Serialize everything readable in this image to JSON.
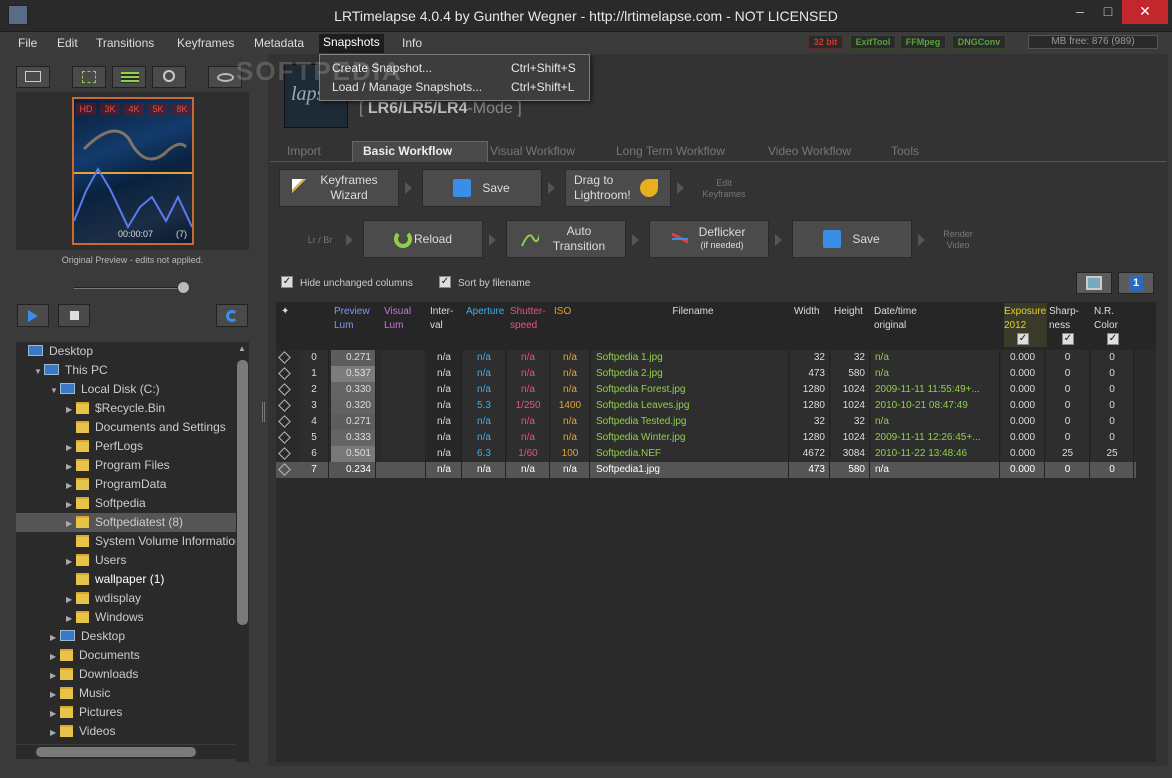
{
  "window": {
    "title": "LRTimelapse 4.0.4 by Gunther Wegner - http://lrtimelapse.com - NOT LICENSED"
  },
  "menu": [
    "File",
    "Edit",
    "Transitions",
    "Keyframes",
    "Metadata",
    "Snapshots",
    "Info"
  ],
  "badges": [
    {
      "label": "32 bit",
      "color": "#e03030"
    },
    {
      "label": "ExifTool",
      "color": "#5aa040"
    },
    {
      "label": "FFMpeg",
      "color": "#5aa040"
    },
    {
      "label": "DNGConv",
      "color": "#5aa040"
    }
  ],
  "mb_free": "MB free: 876  (989)",
  "snapshot_menu": [
    {
      "label": "Create Snapshot...",
      "shortcut": "Ctrl+Shift+S"
    },
    {
      "label": "Load / Manage Snapshots...",
      "shortcut": "Ctrl+Shift+L"
    }
  ],
  "watermark": "SOFTPEDIA",
  "preview": {
    "resolutions": [
      "HD",
      "3K",
      "4K",
      "5K",
      "8K"
    ],
    "time": "00:00:07",
    "count": "(7)",
    "caption": "Original Preview - edits not applied.",
    "slider": 0.95
  },
  "tree": [
    {
      "label": "Desktop",
      "indent": 0,
      "arrow": "",
      "icon": "desktop"
    },
    {
      "label": "This PC",
      "indent": 1,
      "arrow": "▼",
      "icon": "pc"
    },
    {
      "label": "Local Disk (C:)",
      "indent": 2,
      "arrow": "▼",
      "icon": "disk"
    },
    {
      "label": "$Recycle.Bin",
      "indent": 3,
      "arrow": "▶",
      "icon": "folder"
    },
    {
      "label": "Documents and Settings",
      "indent": 3,
      "arrow": "",
      "icon": "folder-link"
    },
    {
      "label": "PerfLogs",
      "indent": 3,
      "arrow": "▶",
      "icon": "folder"
    },
    {
      "label": "Program Files",
      "indent": 3,
      "arrow": "▶",
      "icon": "folder"
    },
    {
      "label": "ProgramData",
      "indent": 3,
      "arrow": "▶",
      "icon": "folder"
    },
    {
      "label": "Softpedia",
      "indent": 3,
      "arrow": "▶",
      "icon": "folder"
    },
    {
      "label": "Softpediatest (8)",
      "indent": 3,
      "arrow": "▶",
      "icon": "folder",
      "selected": true
    },
    {
      "label": "System Volume Information",
      "indent": 3,
      "arrow": "",
      "icon": "folder"
    },
    {
      "label": "Users",
      "indent": 3,
      "arrow": "▶",
      "icon": "folder"
    },
    {
      "label": "wallpaper (1)",
      "indent": 3,
      "arrow": "",
      "icon": "folder",
      "bright": true
    },
    {
      "label": "wdisplay",
      "indent": 3,
      "arrow": "▶",
      "icon": "folder"
    },
    {
      "label": "Windows",
      "indent": 3,
      "arrow": "▶",
      "icon": "folder"
    },
    {
      "label": "Desktop",
      "indent": 2,
      "arrow": "▶",
      "icon": "desktop"
    },
    {
      "label": "Documents",
      "indent": 2,
      "arrow": "▶",
      "icon": "folder"
    },
    {
      "label": "Downloads",
      "indent": 2,
      "arrow": "▶",
      "icon": "folder"
    },
    {
      "label": "Music",
      "indent": 2,
      "arrow": "▶",
      "icon": "folder"
    },
    {
      "label": "Pictures",
      "indent": 2,
      "arrow": "▶",
      "icon": "folder"
    },
    {
      "label": "Videos",
      "indent": 2,
      "arrow": "▶",
      "icon": "folder"
    }
  ],
  "mode": {
    "prefix": "[ ",
    "bold": "LR6/LR5/LR4",
    "suffix": "-Mode ]"
  },
  "tabs": [
    "Import",
    "Basic Workflow",
    "Visual Workflow",
    "Long Term Workflow",
    "Video Workflow",
    "Tools"
  ],
  "workflow": {
    "row1": [
      {
        "label": "Keyframes\nWizard",
        "icon": "wand-icon"
      },
      {
        "label": "Save",
        "icon": "xmp-save-icon"
      },
      {
        "label": "Drag to\nLightroom!",
        "icon": "drag-arrow-icon"
      }
    ],
    "row1_hint": "Edit\nKeyframes",
    "row2_hint_left": "Lr / Br",
    "row2": [
      {
        "label": "Reload",
        "icon": "reload-icon"
      },
      {
        "label": "Auto\nTransition",
        "icon": "curve-icon"
      },
      {
        "label": "Deflicker",
        "sub": "(if needed)",
        "icon": "deflicker-icon"
      },
      {
        "label": "Save",
        "icon": "xmp-save-icon"
      }
    ],
    "row2_hint": "Render\nVideo"
  },
  "options": {
    "hide_unchanged": "Hide unchanged columns",
    "sort_by_filename": "Sort by filename"
  },
  "columns": [
    {
      "key": "sel",
      "label": "✦",
      "color": "#ddd"
    },
    {
      "key": "idx",
      "label": "",
      "color": "#ddd"
    },
    {
      "key": "prev",
      "label": "Preview\nLum",
      "color": "#7b9bf5"
    },
    {
      "key": "vis",
      "label": "Visual\nLum",
      "color": "#c774e0"
    },
    {
      "key": "int",
      "label": "Inter-\nval",
      "color": "#ddd"
    },
    {
      "key": "ap",
      "label": "Aperture",
      "color": "#3ab0e8"
    },
    {
      "key": "sh",
      "label": "Shutter-\nspeed",
      "color": "#e8508a"
    },
    {
      "key": "iso",
      "label": "ISO",
      "color": "#e8a030"
    },
    {
      "key": "fn",
      "label": "Filename",
      "color": "#ddd"
    },
    {
      "key": "w",
      "label": "Width",
      "color": "#ddd"
    },
    {
      "key": "h",
      "label": "Height",
      "color": "#ddd"
    },
    {
      "key": "dt",
      "label": "Date/time\noriginal",
      "color": "#ddd"
    },
    {
      "key": "exp",
      "label": "Exposure\n2012",
      "color": "#e8d020"
    },
    {
      "key": "sharp",
      "label": "Sharp-\nness",
      "color": "#ddd"
    },
    {
      "key": "nr",
      "label": "N.R.\nColor",
      "color": "#ddd"
    }
  ],
  "rows": [
    {
      "idx": "0",
      "prev": "0.271",
      "int": "n/a",
      "ap": "n/a",
      "sh": "n/a",
      "iso": "n/a",
      "fn": "Softpedia 1.jpg",
      "w": "32",
      "h": "32",
      "dt": "n/a",
      "exp": "0.000",
      "sharp": "0",
      "nr": "0"
    },
    {
      "idx": "1",
      "prev": "0.537",
      "int": "n/a",
      "ap": "n/a",
      "sh": "n/a",
      "iso": "n/a",
      "fn": "Softpedia 2.jpg",
      "w": "473",
      "h": "580",
      "dt": "n/a",
      "exp": "0.000",
      "sharp": "0",
      "nr": "0"
    },
    {
      "idx": "2",
      "prev": "0.330",
      "int": "n/a",
      "ap": "n/a",
      "sh": "n/a",
      "iso": "n/a",
      "fn": "Softpedia Forest.jpg",
      "w": "1280",
      "h": "1024",
      "dt": "2009-11-11 11:55:49+...",
      "exp": "0.000",
      "sharp": "0",
      "nr": "0"
    },
    {
      "idx": "3",
      "prev": "0.320",
      "int": "n/a",
      "ap": "5.3",
      "sh": "1/250",
      "iso": "1400",
      "fn": "Softpedia Leaves.jpg",
      "w": "1280",
      "h": "1024",
      "dt": "2010-10-21 08:47:49",
      "exp": "0.000",
      "sharp": "0",
      "nr": "0"
    },
    {
      "idx": "4",
      "prev": "0.271",
      "int": "n/a",
      "ap": "n/a",
      "sh": "n/a",
      "iso": "n/a",
      "fn": "Softpedia Tested.jpg",
      "w": "32",
      "h": "32",
      "dt": "n/a",
      "exp": "0.000",
      "sharp": "0",
      "nr": "0"
    },
    {
      "idx": "5",
      "prev": "0.333",
      "int": "n/a",
      "ap": "n/a",
      "sh": "n/a",
      "iso": "n/a",
      "fn": "Softpedia Winter.jpg",
      "w": "1280",
      "h": "1024",
      "dt": "2009-11-11 12:26:45+...",
      "exp": "0.000",
      "sharp": "0",
      "nr": "0"
    },
    {
      "idx": "6",
      "prev": "0.501",
      "int": "n/a",
      "ap": "6.3",
      "sh": "1/60",
      "iso": "100",
      "fn": "Softpedia.NEF",
      "w": "4672",
      "h": "3084",
      "dt": "2010-11-22 13:48:46",
      "exp": "0.000",
      "sharp": "25",
      "nr": "25"
    },
    {
      "idx": "7",
      "prev": "0.234",
      "int": "n/a",
      "ap": "n/a",
      "sh": "n/a",
      "iso": "n/a",
      "fn": "Softpedia1.jpg",
      "w": "473",
      "h": "580",
      "dt": "n/a",
      "exp": "0.000",
      "sharp": "0",
      "nr": "0",
      "selected": true
    }
  ]
}
